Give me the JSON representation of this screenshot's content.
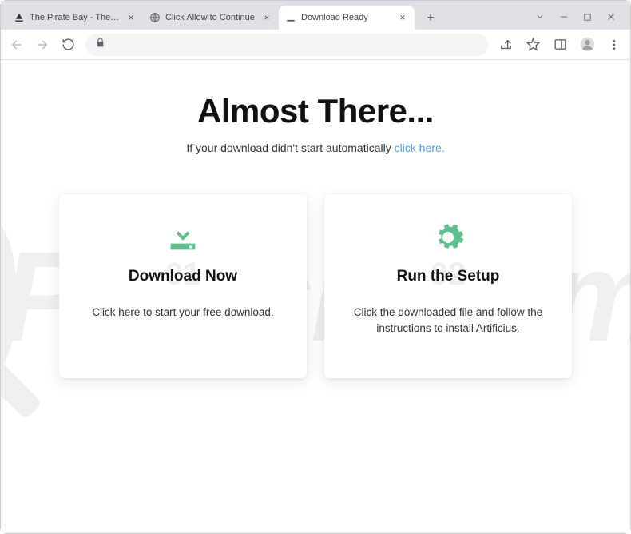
{
  "tabs": [
    {
      "title": "The Pirate Bay - The galaxy's mo",
      "favicon": "ship"
    },
    {
      "title": "Click Allow to Continue",
      "favicon": "globe"
    },
    {
      "title": "Download Ready",
      "favicon": "download",
      "active": true
    }
  ],
  "page": {
    "headline": "Almost There...",
    "subline_prefix": "If your download didn't start automatically ",
    "subline_link": "click here."
  },
  "cards": [
    {
      "num": "01",
      "title": "Download Now",
      "desc": "Click here to start your free download.",
      "icon": "download"
    },
    {
      "num": "02",
      "title": "Run the Setup",
      "desc": "Click the downloaded file and follow the instructions to install Artificius.",
      "icon": "gear"
    }
  ],
  "watermark": "PCrisk.com"
}
